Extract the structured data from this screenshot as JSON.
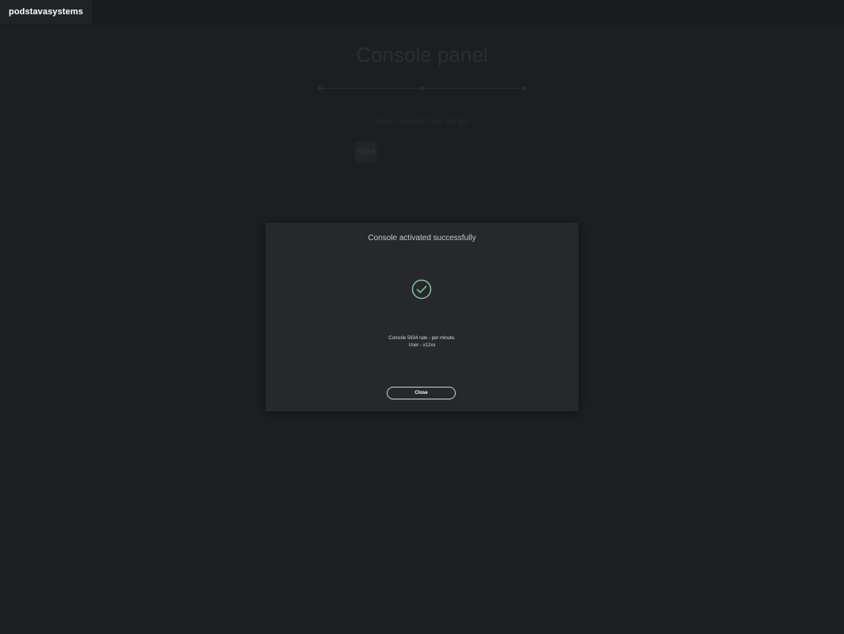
{
  "header": {
    "brand": "podstavasystems"
  },
  "main": {
    "title": "Console panel",
    "select_label": "Select console from the list.",
    "consoles": [
      "5634"
    ]
  },
  "modal": {
    "title": "Console activated successfully",
    "icon": "check-circle-icon",
    "message_line1": "Console 5634 rate - per minute.",
    "message_line2": "User - x12xx",
    "close_label": "Close",
    "accent_color": "#7fc4a0"
  }
}
